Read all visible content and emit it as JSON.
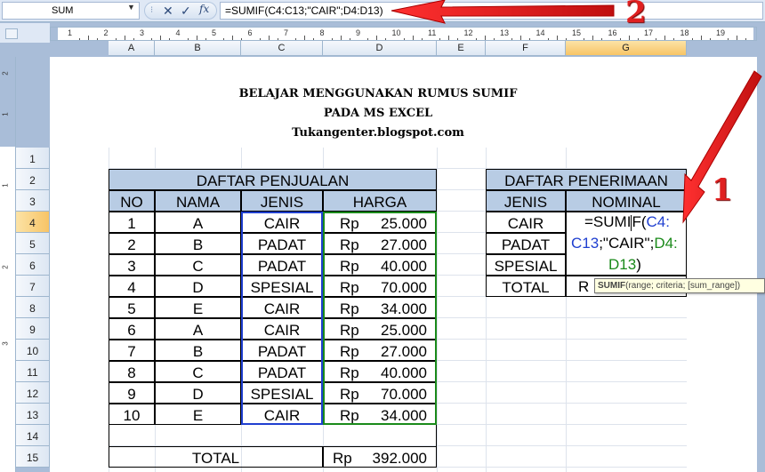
{
  "formula_bar": {
    "name_box": "SUM",
    "cancel_icon": "✕",
    "enter_icon": "✓",
    "fx_label": "fx",
    "formula": "=SUMIF(C4:C13;\"CAIR\";D4:D13)"
  },
  "ruler": {
    "numbers": [
      "1",
      "2",
      "3",
      "4",
      "5",
      "6",
      "7",
      "8",
      "9",
      "10",
      "11",
      "12",
      "13",
      "14",
      "15",
      "16",
      "17",
      "18",
      "19"
    ],
    "vertical_numbers": [
      "2",
      "1",
      "1",
      "2",
      "3"
    ]
  },
  "columns": [
    "A",
    "B",
    "C",
    "D",
    "E",
    "F",
    "G"
  ],
  "rows": [
    "1",
    "2",
    "3",
    "4",
    "5",
    "6",
    "7",
    "8",
    "9",
    "10",
    "11",
    "12",
    "13",
    "14",
    "15"
  ],
  "titles": {
    "line1": "BELAJAR MENGGUNAKAN RUMUS SUMIF",
    "line2": "PADA MS EXCEL",
    "line3": "Tukangenter.blogspot.com"
  },
  "sales_table": {
    "title": "DAFTAR PENJUALAN",
    "headers": [
      "NO",
      "NAMA",
      "JENIS",
      "HARGA"
    ],
    "rows": [
      {
        "no": "1",
        "nama": "A",
        "jenis": "CAIR",
        "rp": "Rp",
        "harga": "25.000"
      },
      {
        "no": "2",
        "nama": "B",
        "jenis": "PADAT",
        "rp": "Rp",
        "harga": "27.000"
      },
      {
        "no": "3",
        "nama": "C",
        "jenis": "PADAT",
        "rp": "Rp",
        "harga": "40.000"
      },
      {
        "no": "4",
        "nama": "D",
        "jenis": "SPESIAL",
        "rp": "Rp",
        "harga": "70.000"
      },
      {
        "no": "5",
        "nama": "E",
        "jenis": "CAIR",
        "rp": "Rp",
        "harga": "34.000"
      },
      {
        "no": "6",
        "nama": "A",
        "jenis": "CAIR",
        "rp": "Rp",
        "harga": "25.000"
      },
      {
        "no": "7",
        "nama": "B",
        "jenis": "PADAT",
        "rp": "Rp",
        "harga": "27.000"
      },
      {
        "no": "8",
        "nama": "C",
        "jenis": "PADAT",
        "rp": "Rp",
        "harga": "40.000"
      },
      {
        "no": "9",
        "nama": "D",
        "jenis": "SPESIAL",
        "rp": "Rp",
        "harga": "70.000"
      },
      {
        "no": "10",
        "nama": "E",
        "jenis": "CAIR",
        "rp": "Rp",
        "harga": "34.000"
      }
    ],
    "total_label": "TOTAL",
    "total_rp": "Rp",
    "total_value": "392.000"
  },
  "receipt_table": {
    "title": "DAFTAR PENERIMAAN",
    "headers": [
      "JENIS",
      "NOMINAL"
    ],
    "rows": [
      "CAIR",
      "PADAT",
      "SPESIAL",
      "TOTAL"
    ],
    "total_prefix": "R",
    "edit_line1_a": "=SUMI",
    "edit_line1_b": "F(",
    "edit_line1_c": "C4:",
    "edit_line2_a": "C13",
    "edit_line2_b": ";\"CAIR\";",
    "edit_line2_c": "D4:",
    "edit_line3_a": "D13",
    "edit_line3_b": ")"
  },
  "tooltip": {
    "func": "SUMIF",
    "args": "(range; criteria; [sum_range])"
  },
  "annotations": {
    "label1": "1",
    "label2": "2"
  },
  "colors": {
    "header_fill": "#b8cce4",
    "range_blue": "#1f3fd0",
    "range_green": "#1a8a1a",
    "arrow_red": "#e02020",
    "selection_orange": "#f7c466"
  }
}
